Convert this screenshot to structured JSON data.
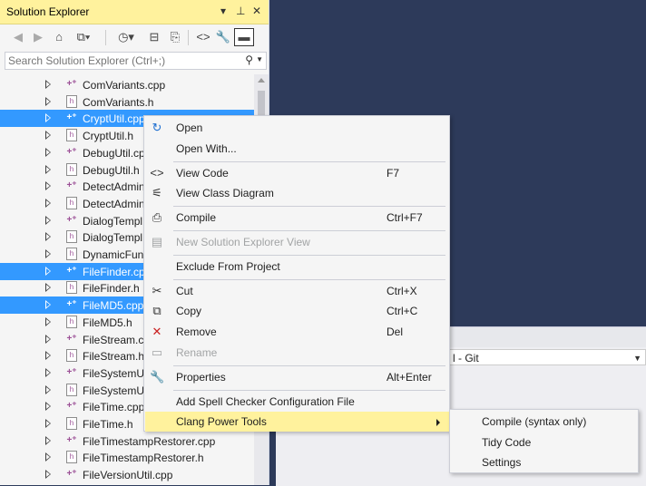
{
  "solution_explorer": {
    "title": "Solution Explorer",
    "title_buttons": [
      "▾",
      "⊥",
      "✕"
    ],
    "search_placeholder": "Search Solution Explorer (Ctrl+;)",
    "files": [
      {
        "name": "ComVariants.cpp",
        "type": "cpp",
        "selected": false
      },
      {
        "name": "ComVariants.h",
        "type": "h",
        "selected": false
      },
      {
        "name": "CryptUtil.cpp",
        "type": "cpp",
        "selected": true
      },
      {
        "name": "CryptUtil.h",
        "type": "h",
        "selected": false
      },
      {
        "name": "DebugUtil.cpp",
        "type": "cpp",
        "selected": false
      },
      {
        "name": "DebugUtil.h",
        "type": "h",
        "selected": false
      },
      {
        "name": "DetectAdmin",
        "type": "cpp",
        "selected": false
      },
      {
        "name": "DetectAdmin",
        "type": "h",
        "selected": false
      },
      {
        "name": "DialogTempl",
        "type": "cpp",
        "selected": false
      },
      {
        "name": "DialogTempl",
        "type": "h",
        "selected": false
      },
      {
        "name": "DynamicFun",
        "type": "h",
        "selected": false
      },
      {
        "name": "FileFinder.cpp",
        "type": "cpp",
        "selected": true
      },
      {
        "name": "FileFinder.h",
        "type": "h",
        "selected": false
      },
      {
        "name": "FileMD5.cpp",
        "type": "cpp",
        "selected": true
      },
      {
        "name": "FileMD5.h",
        "type": "h",
        "selected": false
      },
      {
        "name": "FileStream.cp",
        "type": "cpp",
        "selected": false
      },
      {
        "name": "FileStream.h",
        "type": "h",
        "selected": false
      },
      {
        "name": "FileSystemUt",
        "type": "cpp",
        "selected": false
      },
      {
        "name": "FileSystemUt",
        "type": "h",
        "selected": false
      },
      {
        "name": "FileTime.cpp",
        "type": "cpp",
        "selected": false
      },
      {
        "name": "FileTime.h",
        "type": "h",
        "selected": false
      },
      {
        "name": "FileTimestampRestorer.cpp",
        "type": "cpp",
        "selected": false
      },
      {
        "name": "FileTimestampRestorer.h",
        "type": "h",
        "selected": false
      },
      {
        "name": "FileVersionUtil.cpp",
        "type": "cpp",
        "selected": false
      }
    ]
  },
  "context_menu": {
    "items": [
      {
        "label": "Open",
        "shortcut": "",
        "icon": "open-icon",
        "disabled": false
      },
      {
        "label": "Open With...",
        "shortcut": "",
        "icon": "",
        "disabled": false
      },
      {
        "sep": true
      },
      {
        "label": "View Code",
        "shortcut": "F7",
        "icon": "code-icon",
        "disabled": false
      },
      {
        "label": "View Class Diagram",
        "shortcut": "",
        "icon": "class-diagram-icon",
        "disabled": false
      },
      {
        "sep": true
      },
      {
        "label": "Compile",
        "shortcut": "Ctrl+F7",
        "icon": "compile-icon",
        "disabled": false
      },
      {
        "sep": true
      },
      {
        "label": "New Solution Explorer View",
        "shortcut": "",
        "icon": "new-view-icon",
        "disabled": true
      },
      {
        "sep": true
      },
      {
        "label": "Exclude From Project",
        "shortcut": "",
        "icon": "",
        "disabled": false
      },
      {
        "sep": true
      },
      {
        "label": "Cut",
        "shortcut": "Ctrl+X",
        "icon": "scissors-icon",
        "disabled": false
      },
      {
        "label": "Copy",
        "shortcut": "Ctrl+C",
        "icon": "copy-icon",
        "disabled": false
      },
      {
        "label": "Remove",
        "shortcut": "Del",
        "icon": "remove-icon",
        "disabled": false
      },
      {
        "label": "Rename",
        "shortcut": "",
        "icon": "rename-icon",
        "disabled": true
      },
      {
        "sep": true
      },
      {
        "label": "Properties",
        "shortcut": "Alt+Enter",
        "icon": "wrench-icon",
        "disabled": false
      },
      {
        "sep": true
      },
      {
        "label": "Add Spell Checker Configuration File",
        "shortcut": "",
        "icon": "",
        "disabled": false
      },
      {
        "label": "Clang Power Tools",
        "shortcut": "",
        "icon": "",
        "disabled": false,
        "submenu": true,
        "highlighted": true
      }
    ]
  },
  "submenu": {
    "items": [
      "Compile (syntax only)",
      "Tidy Code",
      "Settings"
    ]
  },
  "background": {
    "combo_text": "l - Git"
  },
  "colors": {
    "title_bar": "#fff29d",
    "selection": "#3399ff",
    "background": "#2d3b5c"
  }
}
